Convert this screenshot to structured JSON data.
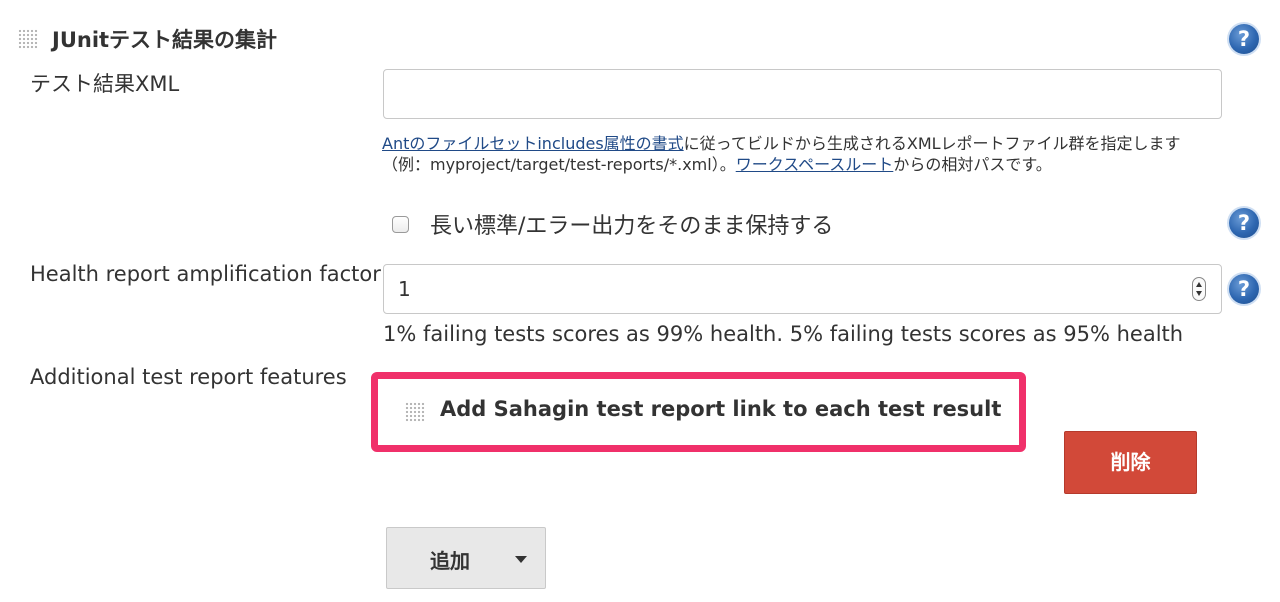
{
  "section": {
    "title": "JUnitテスト結果の集計"
  },
  "test_results_xml": {
    "label": "テスト結果XML",
    "value": "",
    "description": {
      "link1_text": "Antのファイルセットincludes属性の書式",
      "text1": "に従ってビルドから生成されるXMLレポートファイル群を指定します（例：myproject/target/test-reports/*.xml）。",
      "link2_text": "ワークスペースルート",
      "text2": "からの相対パスです。"
    }
  },
  "keep_long_output": {
    "label": "長い標準/エラー出力をそのまま保持する",
    "checked": false
  },
  "health_factor": {
    "label": "Health report amplification factor",
    "value": "1",
    "hint": "1% failing tests scores as 99% health. 5% failing tests scores as 95% health"
  },
  "additional_features": {
    "label": "Additional test report features",
    "items": [
      {
        "title": "Add Sahagin test report link to each test result"
      }
    ],
    "delete_label": "削除",
    "add_label": "追加"
  },
  "colors": {
    "highlight": "#f0306a",
    "delete_button": "#d24939",
    "link": "#204a87",
    "help_icon": "#2e67b1"
  },
  "icons": {
    "help": "help-icon",
    "drag": "drag-handle-icon",
    "dropdown": "caret-down-icon"
  }
}
